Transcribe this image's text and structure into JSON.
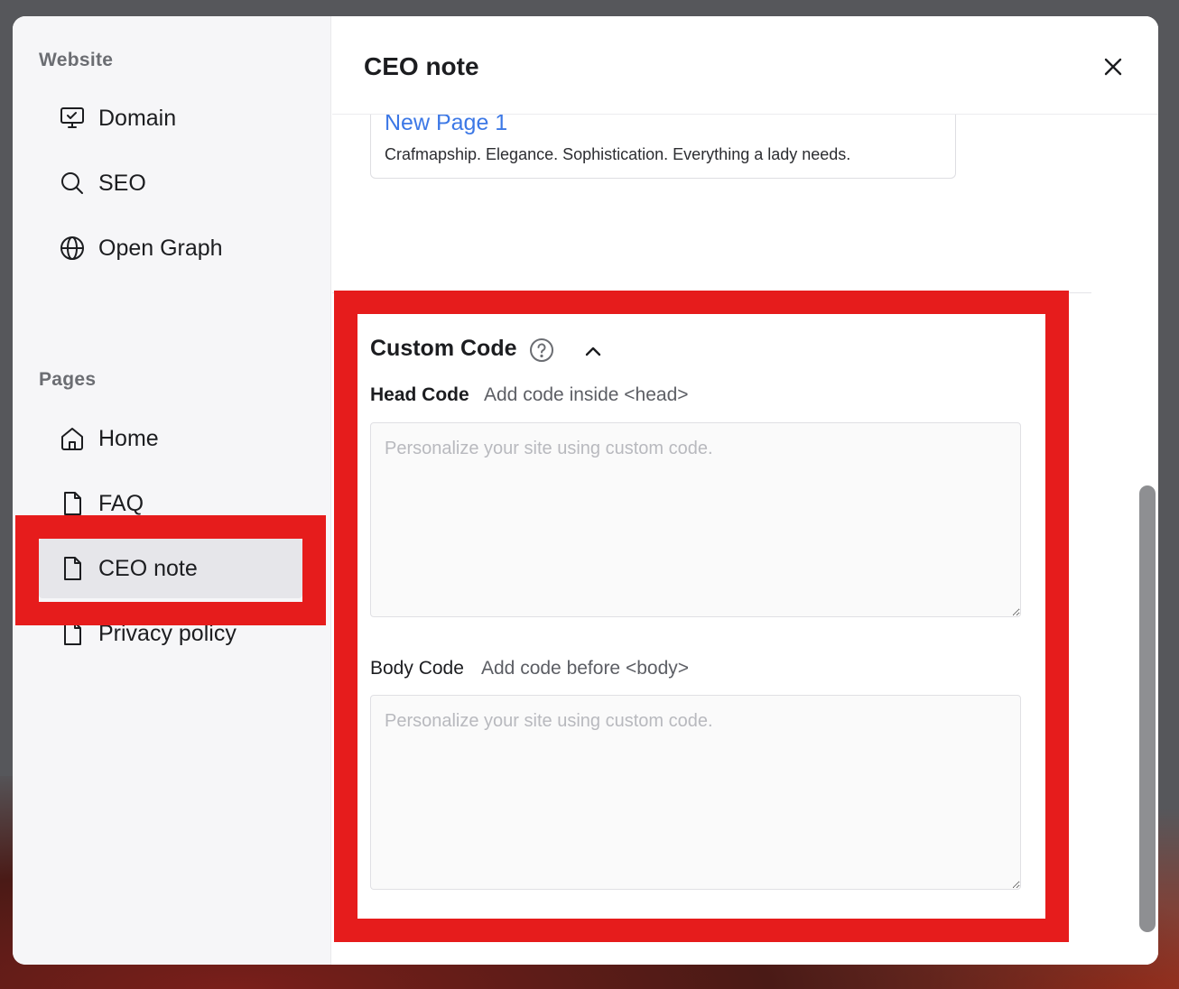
{
  "sidebar": {
    "website_label": "Website",
    "website_items": [
      {
        "label": "Domain",
        "icon": "monitor-check-icon"
      },
      {
        "label": "SEO",
        "icon": "search-icon"
      },
      {
        "label": "Open Graph",
        "icon": "globe-icon"
      }
    ],
    "pages_label": "Pages",
    "page_items": [
      {
        "label": "Home",
        "icon": "home-icon"
      },
      {
        "label": "FAQ",
        "icon": "file-icon"
      },
      {
        "label": "CEO note",
        "icon": "file-icon",
        "active": true
      },
      {
        "label": "Privacy policy",
        "icon": "file-icon"
      }
    ]
  },
  "header": {
    "title": "CEO note",
    "close_icon": "close-icon"
  },
  "preview": {
    "title": "New Page 1",
    "description": "Crafmapship. Elegance. Sophistication. Everything a lady needs."
  },
  "custom_code": {
    "title": "Custom Code",
    "head_label": "Head Code",
    "head_hint": "Add code inside <head>",
    "head_placeholder": "Personalize your site using custom code.",
    "body_label": "Body Code",
    "body_hint": "Add code before <body>",
    "body_placeholder": "Personalize your site using custom code."
  },
  "colors": {
    "highlight": "#e61c1c",
    "link": "#3c78e6",
    "active_bg": "#e6e6ea"
  }
}
